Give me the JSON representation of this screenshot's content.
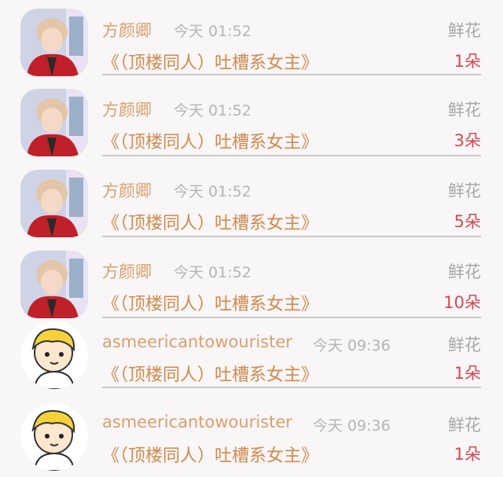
{
  "items": [
    {
      "avatar_type": "photo",
      "name": "方颜卿",
      "time": "今天 01:52",
      "gift": "鲜花",
      "title": "《（顶楼同人）吐槽系女主》",
      "count": "1朵"
    },
    {
      "avatar_type": "photo",
      "name": "方颜卿",
      "time": "今天 01:52",
      "gift": "鲜花",
      "title": "《（顶楼同人）吐槽系女主》",
      "count": "3朵"
    },
    {
      "avatar_type": "photo",
      "name": "方颜卿",
      "time": "今天 01:52",
      "gift": "鲜花",
      "title": "《（顶楼同人）吐槽系女主》",
      "count": "5朵"
    },
    {
      "avatar_type": "photo",
      "name": "方颜卿",
      "time": "今天 01:52",
      "gift": "鲜花",
      "title": "《（顶楼同人）吐槽系女主》",
      "count": "10朵"
    },
    {
      "avatar_type": "cartoon",
      "name": "asmeericantowourister",
      "time": "今天 09:36",
      "gift": "鲜花",
      "title": "《（顶楼同人）吐槽系女主》",
      "count": "1朵"
    },
    {
      "avatar_type": "cartoon",
      "name": "asmeericantowourister",
      "time": "今天 09:36",
      "gift": "鲜花",
      "title": "《（顶楼同人）吐槽系女主》",
      "count": "1朵"
    }
  ]
}
